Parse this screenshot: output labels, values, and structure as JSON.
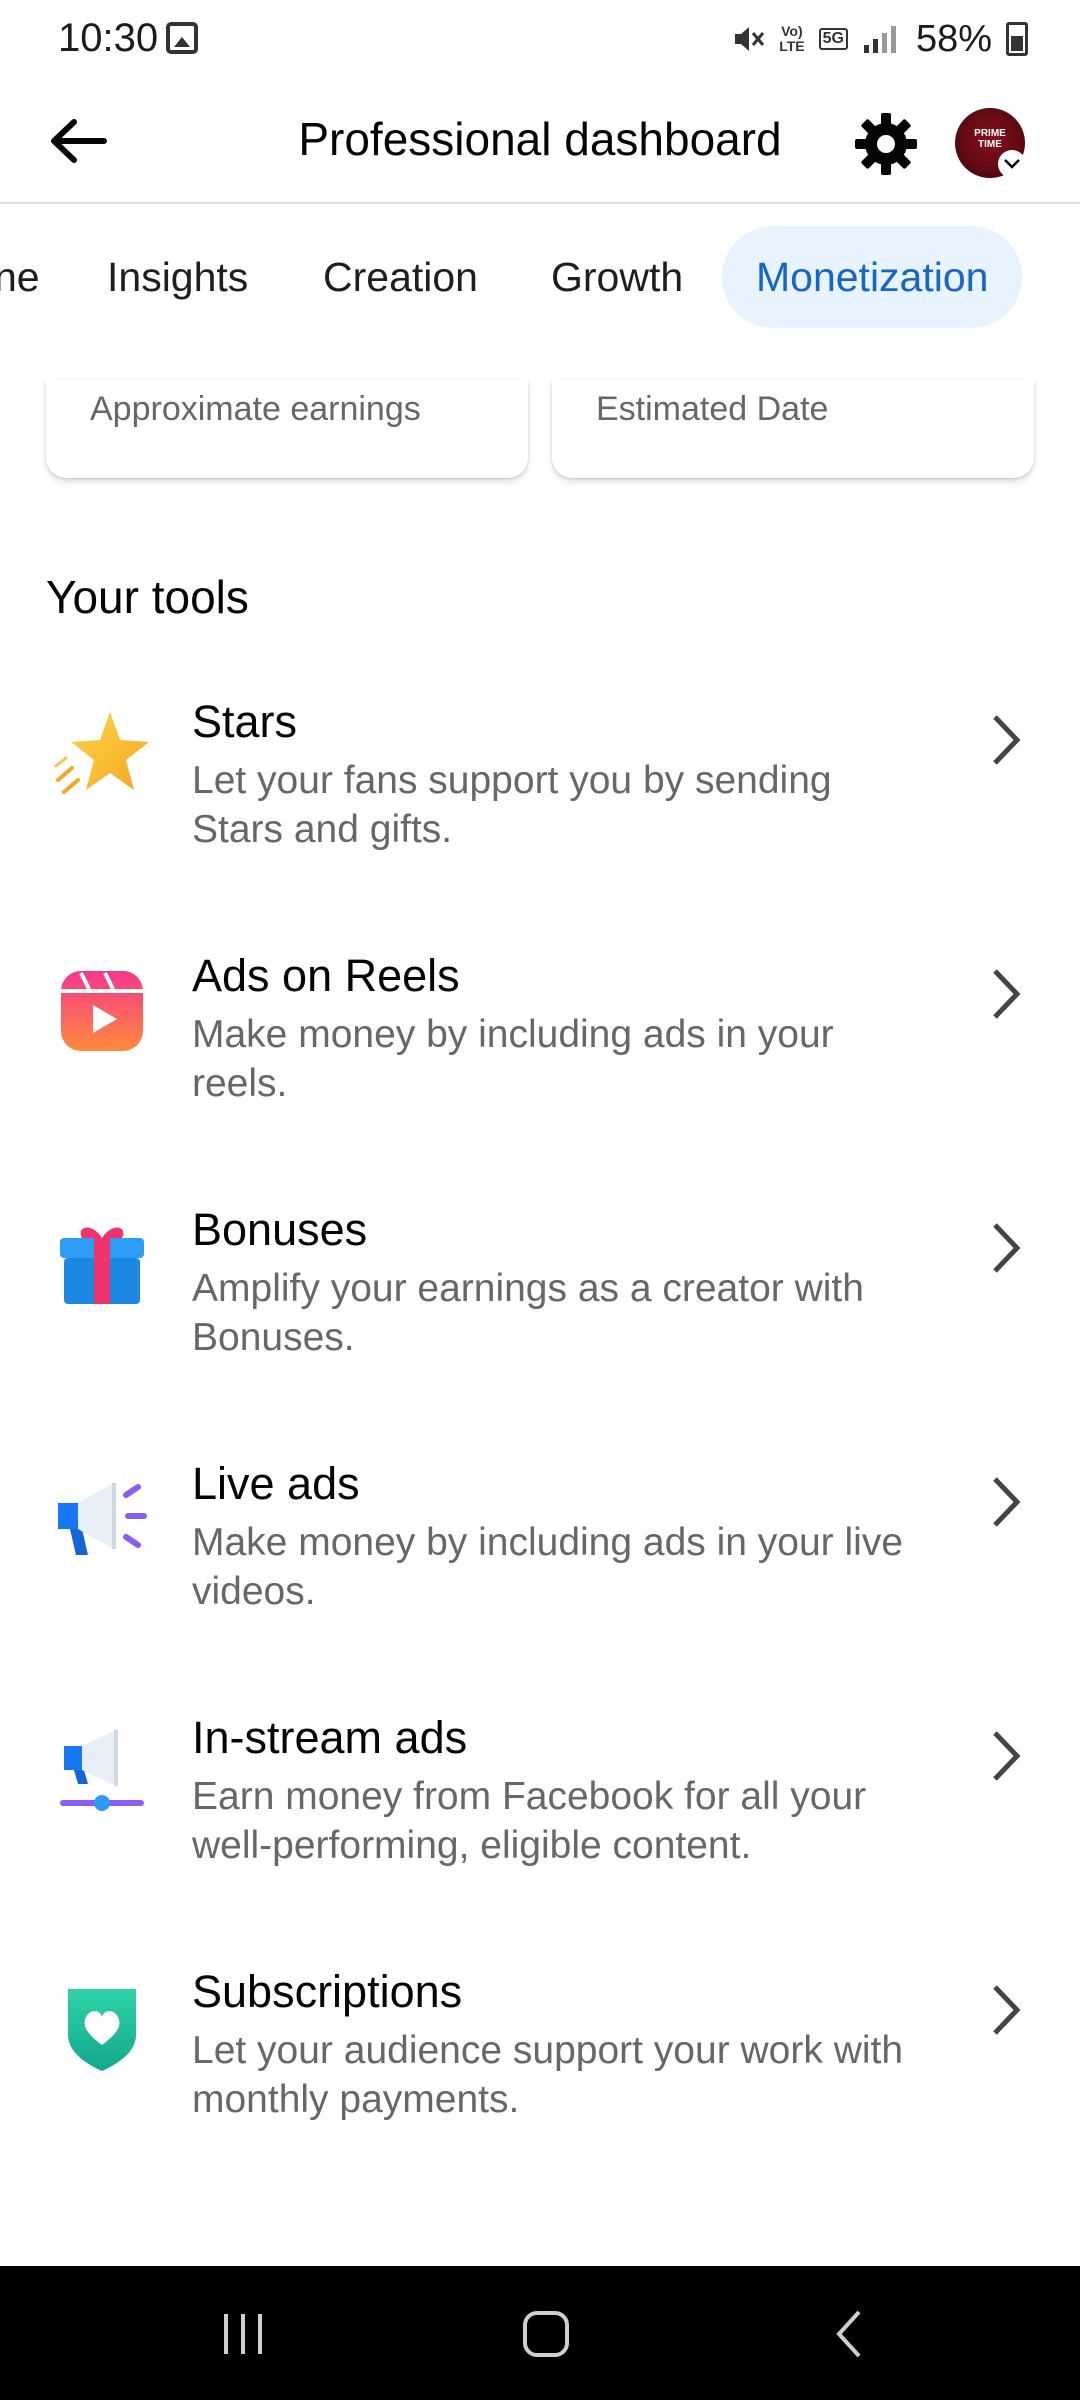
{
  "status_bar": {
    "time": "10:30",
    "volte": "Vo)\nLTE",
    "network": "5G",
    "battery": "58%"
  },
  "header": {
    "title": "Professional dashboard",
    "avatar_text": "PRIME\nTIME"
  },
  "tabs": [
    {
      "label": "ne"
    },
    {
      "label": "Insights"
    },
    {
      "label": "Creation"
    },
    {
      "label": "Growth"
    },
    {
      "label": "Monetization",
      "active": true
    }
  ],
  "cards": [
    {
      "label": "Approximate earnings"
    },
    {
      "label": "Estimated Date"
    }
  ],
  "tools_section": {
    "title": "Your tools",
    "items": [
      {
        "name": "Stars",
        "desc": "Let your fans support you by sending Stars and gifts.",
        "icon": "star-icon"
      },
      {
        "name": "Ads on Reels",
        "desc": "Make money by including ads in your reels.",
        "icon": "reels-icon"
      },
      {
        "name": "Bonuses",
        "desc": "Amplify your earnings as a creator with Bonuses.",
        "icon": "gift-icon"
      },
      {
        "name": "Live ads",
        "desc": "Make money by including ads in your live videos.",
        "icon": "megaphone-icon"
      },
      {
        "name": "In-stream ads",
        "desc": "Earn money from Facebook for all your well-performing, eligible content.",
        "icon": "instream-megaphone-icon"
      },
      {
        "name": "Subscriptions",
        "desc": "Let your audience support your work with monthly payments.",
        "icon": "heart-shield-icon"
      }
    ]
  },
  "colors": {
    "accent": "#1864c8",
    "active_tab_bg": "#e7f3ff",
    "secondary_text": "#65676b"
  }
}
